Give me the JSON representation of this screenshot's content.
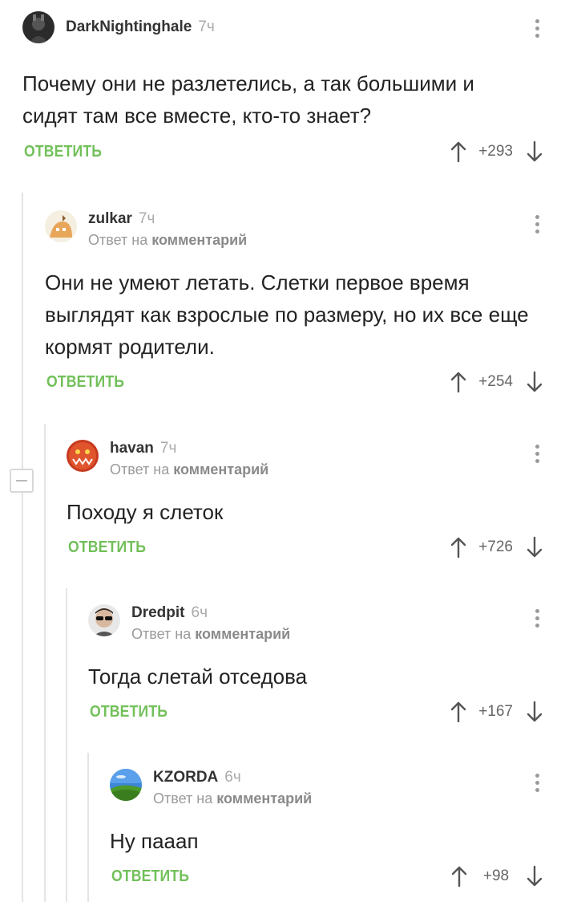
{
  "comments": [
    {
      "user": "DarkNightinghale",
      "time": "7ч",
      "reply_prefix": "",
      "reply_target": "",
      "text": "Почему они не разлетелись, а так большими и сидят там все вместе, кто-то знает?",
      "reply_label": "ОТВЕТИТЬ",
      "score": "+293",
      "avatar": "dark-knight-avatar"
    },
    {
      "user": "zulkar",
      "time": "7ч",
      "reply_prefix": "Ответ на",
      "reply_target": "комментарий",
      "text": "Они не умеют летать. Слетки первое время выглядят как взрослые по размеру, но их все еще кормят родители.",
      "reply_label": "ОТВЕТИТЬ",
      "score": "+254",
      "avatar": "cartoon-avatar"
    },
    {
      "user": "havan",
      "time": "7ч",
      "reply_prefix": "Ответ на",
      "reply_target": "комментарий",
      "text": "Походу я слеток",
      "reply_label": "ОТВЕТИТЬ",
      "score": "+726",
      "avatar": "monster-avatar"
    },
    {
      "user": "Dredpit",
      "time": "6ч",
      "reply_prefix": "Ответ на",
      "reply_target": "комментарий",
      "text": "Тогда слетай отседова",
      "reply_label": "ОТВЕТИТЬ",
      "score": "+167",
      "avatar": "sunglasses-man-avatar"
    },
    {
      "user": "KZORDA",
      "time": "6ч",
      "reply_prefix": "Ответ на",
      "reply_target": "комментарий",
      "text": "Ну пааап",
      "reply_label": "ОТВЕТИТЬ",
      "score": "+98",
      "avatar": "landscape-avatar"
    }
  ],
  "colors": {
    "accent": "#72c05a",
    "thread_line": "#e4e4e4",
    "muted": "#9a9a9a"
  }
}
